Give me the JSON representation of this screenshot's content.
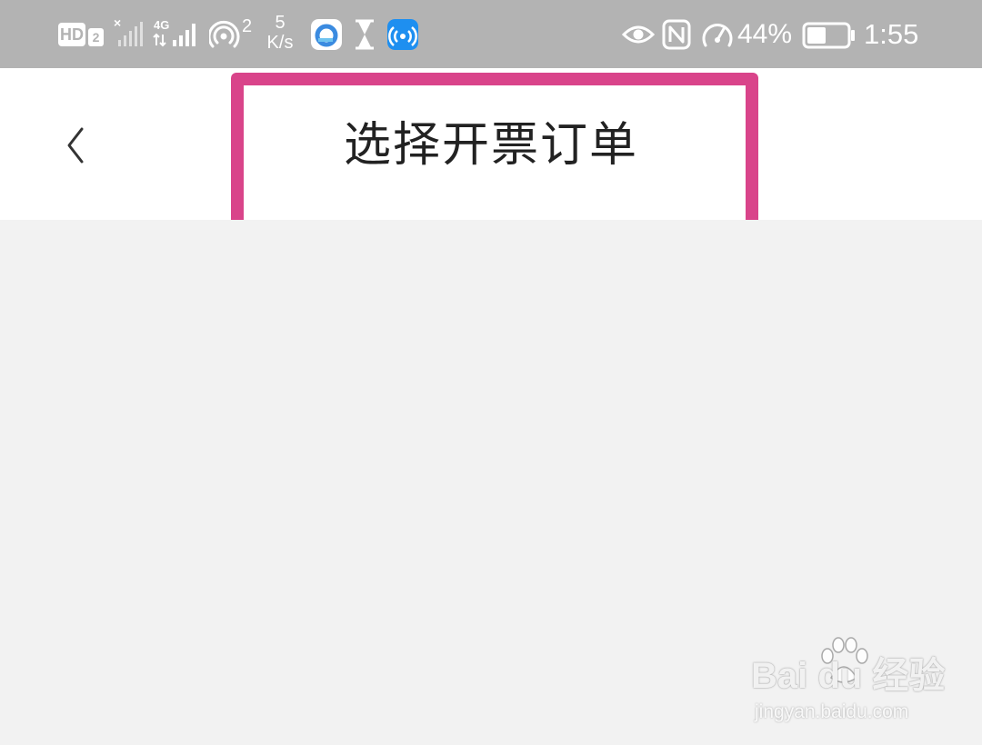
{
  "status_bar": {
    "hd_label": "HD",
    "hd_sub": "2",
    "network_type": "4G",
    "hotspot_count": "2",
    "speed_value": "5",
    "speed_unit": "K/s",
    "battery_percent": "44%",
    "time": "1:55",
    "icons": [
      "hd-icon",
      "signal-no-service-icon",
      "signal-4g-icon",
      "hotspot-icon",
      "browser-app-icon",
      "hourglass-icon",
      "wifi-app-icon",
      "eye-icon",
      "nfc-icon",
      "speedometer-icon",
      "battery-icon"
    ]
  },
  "header": {
    "back_icon": "chevron-left-icon",
    "title": "选择开票订单"
  },
  "annotation": {
    "highlight_color": "#d9448a"
  },
  "watermark": {
    "brand": "Bai du 经验",
    "url": "jingyan.baidu.com"
  },
  "colors": {
    "status_bar_bg": "#b3b3b3",
    "nav_bg": "#ffffff",
    "content_bg": "#f2f2f2"
  }
}
